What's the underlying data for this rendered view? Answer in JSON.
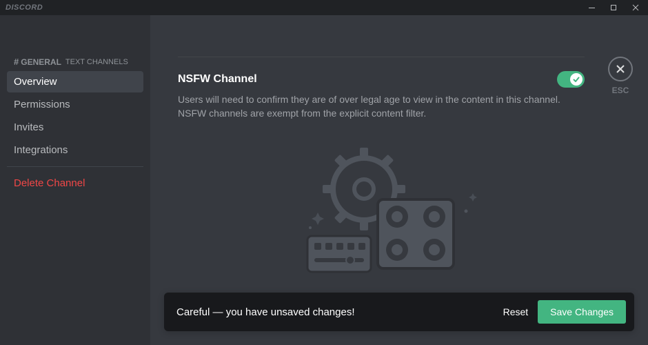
{
  "titlebar": {
    "wordmark": "DISCORD"
  },
  "close": {
    "esc": "ESC"
  },
  "sidebar": {
    "header_channel": "GENERAL",
    "header_suffix": "TEXT CHANNELS",
    "items": [
      {
        "label": "Overview"
      },
      {
        "label": "Permissions"
      },
      {
        "label": "Invites"
      },
      {
        "label": "Integrations"
      }
    ],
    "delete_label": "Delete Channel"
  },
  "setting": {
    "title": "NSFW Channel",
    "description": "Users will need to confirm they are of over legal age to view in the content in this channel. NSFW channels are exempt from the explicit content filter.",
    "enabled": true
  },
  "unsaved": {
    "message": "Careful — you have unsaved changes!",
    "reset": "Reset",
    "save": "Save Changes"
  }
}
